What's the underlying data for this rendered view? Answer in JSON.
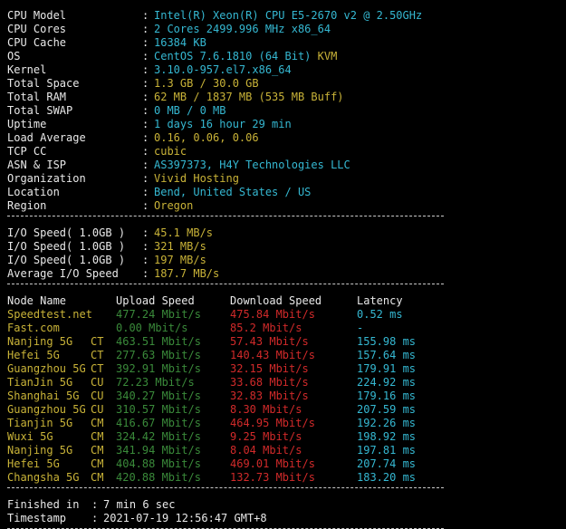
{
  "separator": "-------------------------------------------------------------------------",
  "sysinfo": [
    {
      "label": "CPU Model",
      "value": "Intel(R) Xeon(R) CPU E5-2670 v2 @ 2.50GHz",
      "cls": "c"
    },
    {
      "label": "CPU Cores",
      "value": "2 Cores 2499.996 MHz x86_64",
      "cls": "c"
    },
    {
      "label": "CPU Cache",
      "value": "16384 KB",
      "cls": "c"
    },
    {
      "label": "OS",
      "value": "CentOS 7.6.1810 (64 Bit)",
      "value2": "KVM",
      "cls": "c"
    },
    {
      "label": "Kernel",
      "value": "3.10.0-957.el7.x86_64",
      "cls": "c"
    },
    {
      "label": "Total Space",
      "value": "1.3 GB / 30.0 GB",
      "cls": "y"
    },
    {
      "label": "Total RAM",
      "value": "62 MB / 1837 MB (535 MB Buff)",
      "cls": "y"
    },
    {
      "label": "Total SWAP",
      "value": "0 MB / 0 MB",
      "cls": "c"
    },
    {
      "label": "Uptime",
      "value": "1 days 16 hour 29 min",
      "cls": "c"
    },
    {
      "label": "Load Average",
      "value": "0.16, 0.06, 0.06",
      "cls": "y"
    },
    {
      "label": "TCP CC",
      "value": "cubic",
      "cls": "y"
    },
    {
      "label": "ASN & ISP",
      "value": "AS397373, H4Y Technologies LLC",
      "cls": "c"
    },
    {
      "label": "Organization",
      "value": "Vivid Hosting",
      "cls": "y"
    },
    {
      "label": "Location",
      "value": "Bend, United States / US",
      "cls": "c"
    },
    {
      "label": "Region",
      "value": "Oregon",
      "cls": "y"
    }
  ],
  "io": [
    {
      "label": "I/O Speed( 1.0GB )",
      "value": "45.1 MB/s"
    },
    {
      "label": "I/O Speed( 1.0GB )",
      "value": "321 MB/s"
    },
    {
      "label": "I/O Speed( 1.0GB )",
      "value": "197 MB/s"
    },
    {
      "label": "Average I/O Speed",
      "value": "187.7 MB/s"
    }
  ],
  "speed": {
    "headers": {
      "node": "Node Name",
      "upload": "Upload Speed",
      "download": "Download Speed",
      "latency": "Latency"
    },
    "rows": [
      {
        "node": "Speedtest.net",
        "isp": "",
        "upload": "477.24 Mbit/s",
        "download": "475.84 Mbit/s",
        "latency": "0.52 ms"
      },
      {
        "node": "Fast.com",
        "isp": "",
        "upload": "0.00 Mbit/s",
        "download": "85.2 Mbit/s",
        "latency": "-"
      },
      {
        "node": "Nanjing 5G",
        "isp": "CT",
        "upload": "463.51 Mbit/s",
        "download": "57.43 Mbit/s",
        "latency": "155.98 ms"
      },
      {
        "node": "Hefei 5G",
        "isp": "CT",
        "upload": "277.63 Mbit/s",
        "download": "140.43 Mbit/s",
        "latency": "157.64 ms"
      },
      {
        "node": "Guangzhou 5G",
        "isp": "CT",
        "upload": "392.91 Mbit/s",
        "download": "32.15 Mbit/s",
        "latency": "179.91 ms"
      },
      {
        "node": "TianJin 5G",
        "isp": "CU",
        "upload": "72.23 Mbit/s",
        "download": "33.68 Mbit/s",
        "latency": "224.92 ms"
      },
      {
        "node": "Shanghai 5G",
        "isp": "CU",
        "upload": "340.27 Mbit/s",
        "download": "32.83 Mbit/s",
        "latency": "179.16 ms"
      },
      {
        "node": "Guangzhou 5G",
        "isp": "CU",
        "upload": "310.57 Mbit/s",
        "download": "8.30 Mbit/s",
        "latency": "207.59 ms"
      },
      {
        "node": "Tianjin 5G",
        "isp": "CM",
        "upload": "416.67 Mbit/s",
        "download": "464.95 Mbit/s",
        "latency": "192.26 ms"
      },
      {
        "node": "Wuxi 5G",
        "isp": "CM",
        "upload": "324.42 Mbit/s",
        "download": "9.25 Mbit/s",
        "latency": "198.92 ms"
      },
      {
        "node": "Nanjing 5G",
        "isp": "CM",
        "upload": "341.94 Mbit/s",
        "download": "8.04 Mbit/s",
        "latency": "197.81 ms"
      },
      {
        "node": "Hefei 5G",
        "isp": "CM",
        "upload": "404.88 Mbit/s",
        "download": "469.01 Mbit/s",
        "latency": "207.74 ms"
      },
      {
        "node": "Changsha 5G",
        "isp": "CM",
        "upload": "420.88 Mbit/s",
        "download": "132.73 Mbit/s",
        "latency": "183.20 ms"
      }
    ]
  },
  "footer": [
    {
      "label": "Finished in",
      "value": "7 min 6 sec"
    },
    {
      "label": "Timestamp",
      "value": "2021-07-19 12:56:47 GMT+8"
    }
  ]
}
